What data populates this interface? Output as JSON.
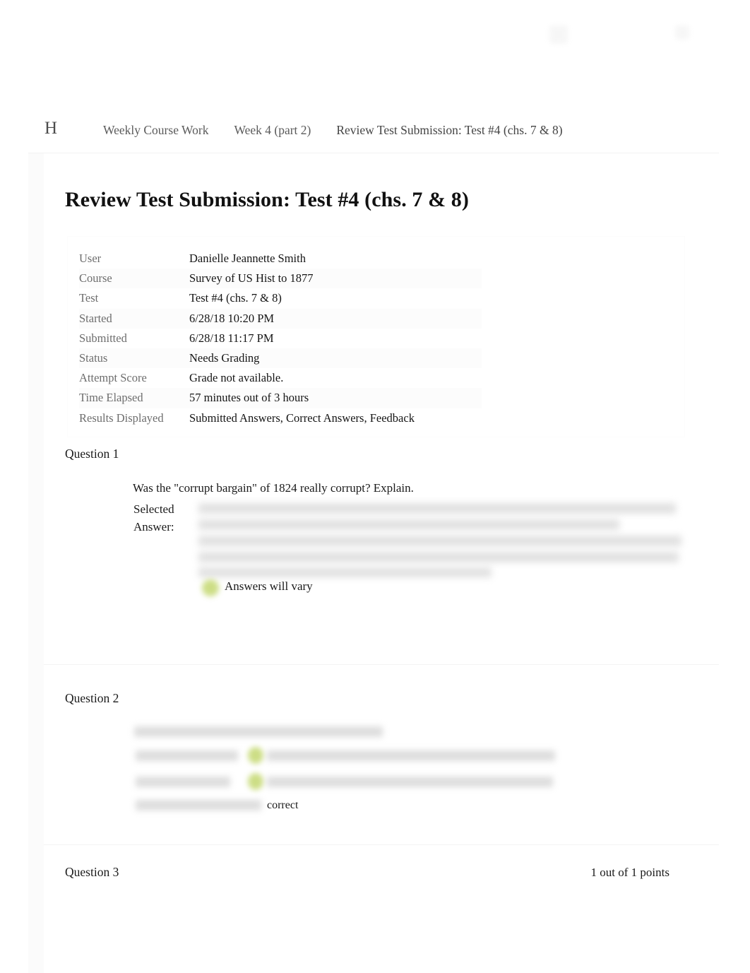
{
  "window": {
    "chrome_icons": [
      "blurred-icon",
      "blurred-icon"
    ]
  },
  "breadcrumb": {
    "home_label": "H",
    "items": [
      {
        "label": "Weekly Course Work"
      },
      {
        "label": "Week 4 (part 2)"
      },
      {
        "label": "Review Test Submission: Test #4 (chs. 7 & 8)"
      }
    ]
  },
  "page": {
    "title": "Review Test Submission: Test #4 (chs. 7 & 8)"
  },
  "info": {
    "rows": [
      {
        "label": "User",
        "value": "Danielle Jeannette Smith"
      },
      {
        "label": "Course",
        "value": "Survey of US Hist to 1877"
      },
      {
        "label": "Test",
        "value": "Test #4 (chs. 7 & 8)"
      },
      {
        "label": "Started",
        "value": "6/28/18 10:20 PM"
      },
      {
        "label": "Submitted",
        "value": "6/28/18 11:17 PM"
      },
      {
        "label": "Status",
        "value": "Needs Grading"
      },
      {
        "label": "Attempt Score",
        "value": "Grade not available."
      },
      {
        "label": "Time Elapsed",
        "value": "57 minutes out of 3 hours"
      },
      {
        "label": "Results Displayed",
        "value": "Submitted Answers, Correct Answers, Feedback"
      }
    ]
  },
  "questions": [
    {
      "title": "Question 1",
      "points": "",
      "prompt": "Was the \"corrupt bargain\" of 1824 really corrupt? Explain.",
      "selected_answer_label": "Selected Answer:",
      "selected_answer_text": "",
      "feedback": "Answers will vary"
    },
    {
      "title": "Question 2",
      "points": "",
      "prompt": "",
      "selected_answer_label": "",
      "correct_answer_label": "",
      "response_feedback_label": "",
      "feedback": "correct"
    },
    {
      "title": "Question 3",
      "points": "1 out of 1 points"
    }
  ],
  "colors": {
    "feedback_marker": "#c4d870",
    "text": "#1a1a1a",
    "muted_text": "#6d6d6d",
    "background": "#ffffff"
  }
}
